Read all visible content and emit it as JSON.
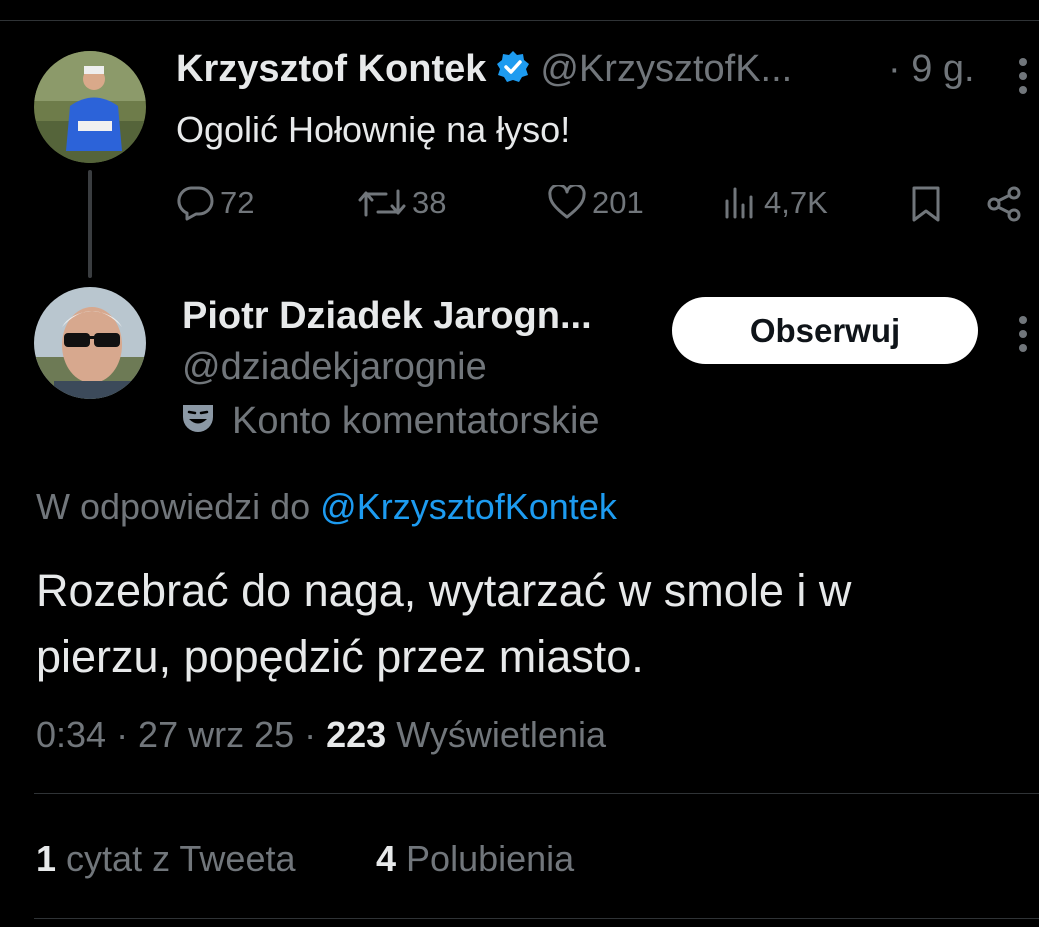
{
  "parent_tweet": {
    "author_name": "Krzysztof Kontek",
    "author_handle": "@KrzysztofK...",
    "time": "· 9 g.",
    "text": "Ogolić Hołownię na łyso!",
    "actions": {
      "replies": "72",
      "retweets": "38",
      "likes": "201",
      "views": "4,7K"
    },
    "icons": [
      "reply-icon",
      "retweet-icon",
      "heart-icon",
      "views-icon",
      "bookmark-icon",
      "share-icon"
    ]
  },
  "reply_tweet": {
    "author_name": "Piotr Dziadek Jarogn...",
    "author_handle": "@dziadekjarognie",
    "account_label": "Konto komentatorskie",
    "follow_label": "Obserwuj",
    "reply_prefix": "W odpowiedzi do",
    "reply_to_handle": "@KrzysztofKontek",
    "text_line1": "Rozebrać do naga, wytarzać w smole i w",
    "text_line2": "pierzu, popędzić przez miasto.",
    "meta_time": "0:34 · 27 wrz 25 ·",
    "views_count": "223",
    "views_label": "Wyświetlenia",
    "quote_count": "1",
    "quote_label": "cytat z Tweeta",
    "likes_count": "4",
    "likes_label": "Polubienia"
  },
  "colors": {
    "background": "#000000",
    "text": "#e7e9ea",
    "secondary": "#71767b",
    "accent": "#1d9bf0",
    "verified": "#1d9bf0"
  }
}
